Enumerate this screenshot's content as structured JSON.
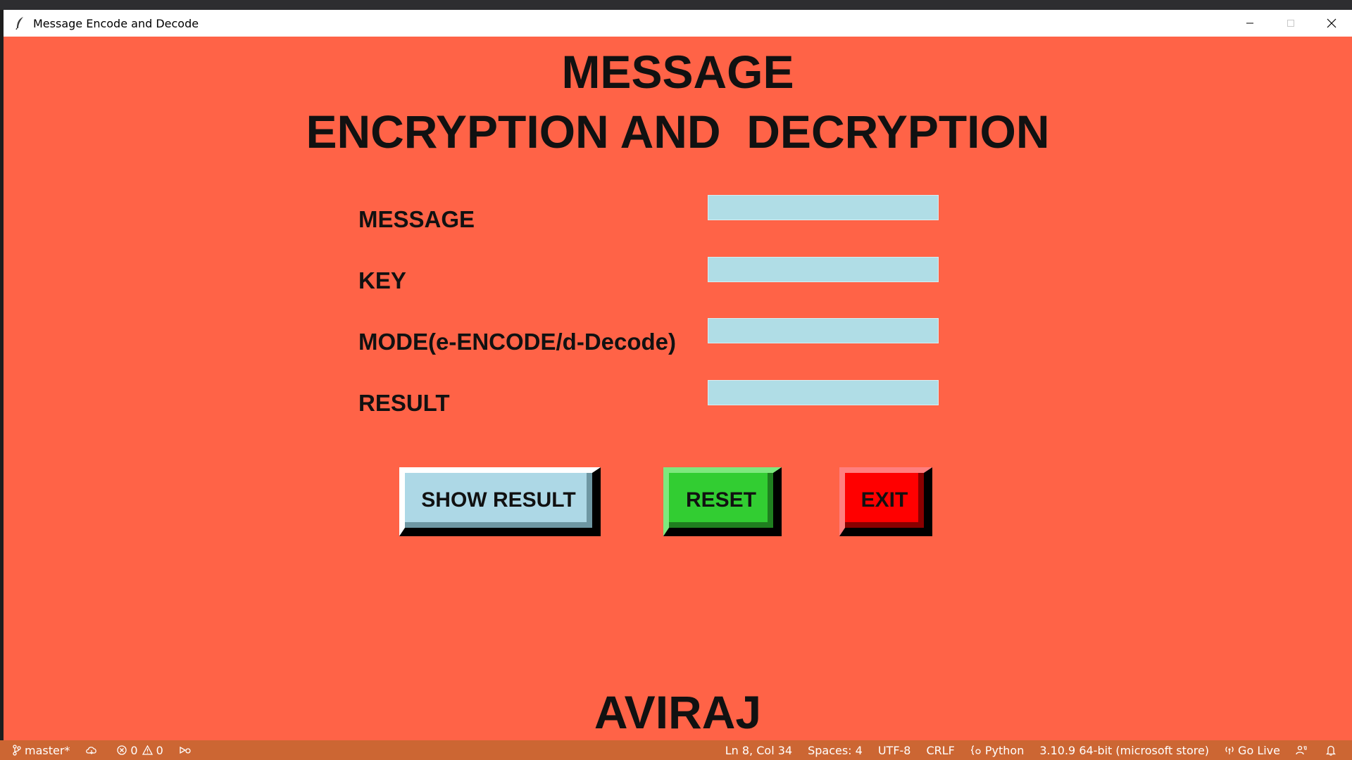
{
  "window": {
    "title": "Message Encode and Decode",
    "background": "#ff6347"
  },
  "heading": {
    "line1": "MESSAGE",
    "line2": "ENCRYPTION AND  DECRYPTION"
  },
  "form": {
    "message_label": "MESSAGE",
    "key_label": "KEY",
    "mode_label": "MODE(e-ENCODE/d-Decode)",
    "result_label": "RESULT",
    "message_value": "",
    "key_value": "",
    "mode_value": "",
    "result_value": "",
    "field_color": "#b0dde6"
  },
  "buttons": {
    "show_result": "SHOW RESULT",
    "reset": "RESET",
    "exit": "EXIT",
    "show_color": "#add8e6",
    "reset_color": "#32cd32",
    "exit_color": "#ff0000"
  },
  "footer": {
    "name": "AVIRAJ"
  },
  "statusbar": {
    "branch": "master*",
    "errors": "0",
    "warnings": "0",
    "position": "Ln 8, Col 34",
    "spaces": "Spaces: 4",
    "encoding": "UTF-8",
    "eol": "CRLF",
    "language": "Python",
    "interpreter": "3.10.9 64-bit (microsoft store)",
    "go_live": "Go Live",
    "color": "#cc6633"
  }
}
